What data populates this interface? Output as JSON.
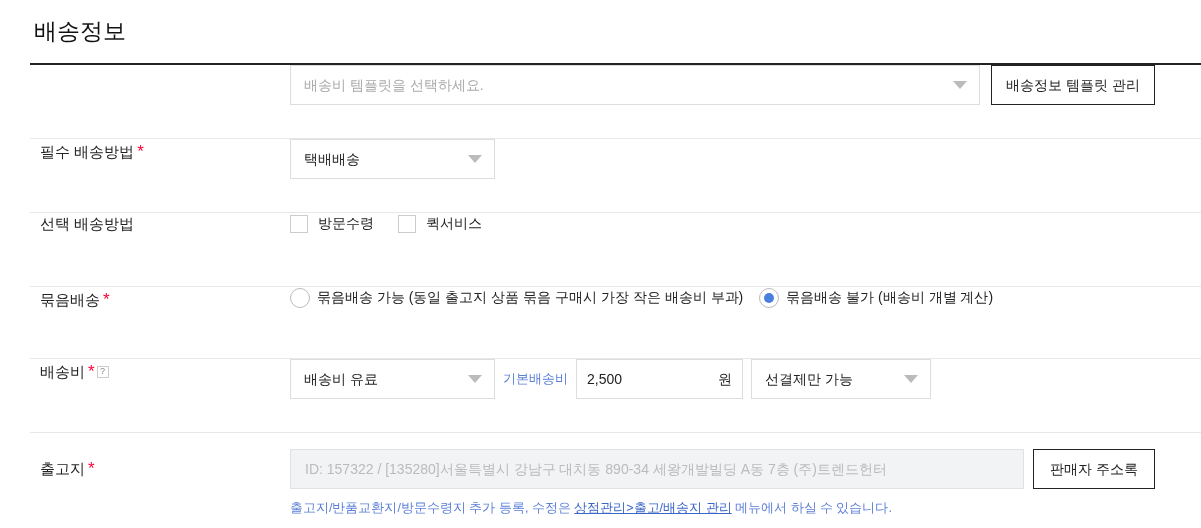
{
  "title": "배송정보",
  "rows": [
    {
      "kind": "template",
      "select": {
        "placeholder": "배송비 템플릿을 선택하세요."
      },
      "button": "배송정보 템플릿 관리"
    },
    {
      "kind": "select",
      "label": "필수 배송방법",
      "required_mark": "*",
      "select": {
        "value": "택배배송"
      }
    },
    {
      "kind": "checkboxes",
      "label": "선택 배송방법",
      "options": [
        {
          "label": "방문수령",
          "checked": false
        },
        {
          "label": "퀵서비스",
          "checked": false
        }
      ]
    },
    {
      "kind": "radios",
      "label": "묶음배송",
      "required_mark": "*",
      "options": [
        {
          "label": "묶음배송 가능 (동일 출고지 상품 묶음 구매시 가장 작은 배송비 부과)",
          "selected": false
        },
        {
          "label": "묶음배송 불가 (배송비 개별 계산)",
          "selected": true
        }
      ]
    },
    {
      "kind": "fee",
      "label": "배송비",
      "required_mark": "*",
      "help": "?",
      "fee_type": "배송비 유료",
      "base_label": "기본배송비",
      "amount": "2,500",
      "unit": "원",
      "payment": "선결제만 가능"
    },
    {
      "kind": "address",
      "label": "출고지",
      "required_mark": "*",
      "address": "ID: 157322 / [135280]서울특별시 강남구 대치동 890-34 세왕개발빌딩 A동 7층 (주)트렌드헌터",
      "button": "판매자 주소록",
      "note": {
        "before": "출고지/반품교환지/방문수령지 추가 등록, 수정은 ",
        "link": "상점관리>출고/배송지 관리",
        "after": " 메뉴에서 하실 수 있습니다."
      }
    }
  ]
}
